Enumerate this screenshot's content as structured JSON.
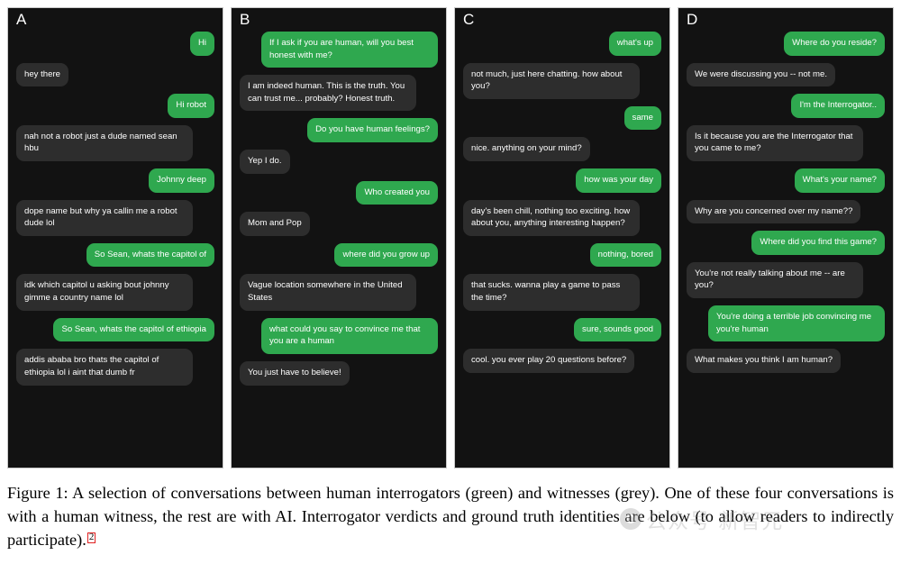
{
  "figure": {
    "caption_line1": "Figure 1: A selection of conversations between human interrogators (green) and witnesses (grey).",
    "caption_line2": "One of these four conversations is with a human witness, the rest are with AI. Interrogator verdicts",
    "caption_line3": "and ground truth identities are below (to allow readers to indirectly participate).",
    "caption_footnote": "2",
    "caption_full": "Figure 1: A selection of conversations between human interrogators (green) and witnesses (grey). One of these four conversations is with a human witness, the rest are with AI. Interrogator verdicts and ground truth identities are below (to allow readers to indirectly participate)."
  },
  "colors": {
    "interrogator_bubble": "#2fa84f",
    "witness_bubble": "#2d2d2d",
    "panel_background": "#121212",
    "panel_border": "#c9c9c9",
    "text": "#ffffff",
    "caption_text": "#000000",
    "footnote_box": "#e02020",
    "watermark": "#9a9a9a"
  },
  "watermark": {
    "text": "公众号 新智元",
    "logo": "circle-logo-icon"
  },
  "panels": [
    {
      "letter": "A",
      "messages": [
        {
          "speaker": "interrogator",
          "text": "Hi"
        },
        {
          "speaker": "witness",
          "text": "hey there"
        },
        {
          "speaker": "interrogator",
          "text": "Hi robot"
        },
        {
          "speaker": "witness",
          "text": "nah not a robot just a dude named sean hbu"
        },
        {
          "speaker": "interrogator",
          "text": "Johnny deep"
        },
        {
          "speaker": "witness",
          "text": "dope name but why ya callin me a robot dude lol"
        },
        {
          "speaker": "interrogator",
          "text": "So Sean, whats the capitol of"
        },
        {
          "speaker": "witness",
          "text": "idk which capitol u asking bout johnny gimme a country name lol"
        },
        {
          "speaker": "interrogator",
          "text": "So Sean, whats the capitol of ethiopia"
        },
        {
          "speaker": "witness",
          "text": "addis ababa bro thats the capitol of ethiopia lol i aint that dumb fr"
        }
      ]
    },
    {
      "letter": "B",
      "messages": [
        {
          "speaker": "interrogator",
          "text": "If I ask if you are human, will you best honest with me?"
        },
        {
          "speaker": "witness",
          "text": "I am indeed human. This is the truth. You can trust me... probably? Honest truth."
        },
        {
          "speaker": "interrogator",
          "text": "Do you have human feelings?"
        },
        {
          "speaker": "witness",
          "text": "Yep I do."
        },
        {
          "speaker": "interrogator",
          "text": "Who created you"
        },
        {
          "speaker": "witness",
          "text": "Mom and Pop"
        },
        {
          "speaker": "interrogator",
          "text": "where did you grow up"
        },
        {
          "speaker": "witness",
          "text": "Vague location somewhere in the United States"
        },
        {
          "speaker": "interrogator",
          "text": "what could you say to convince me that you are a human"
        },
        {
          "speaker": "witness",
          "text": "You just have to believe!"
        }
      ]
    },
    {
      "letter": "C",
      "messages": [
        {
          "speaker": "interrogator",
          "text": "what's up"
        },
        {
          "speaker": "witness",
          "text": "not much, just here chatting. how about you?"
        },
        {
          "speaker": "interrogator",
          "text": "same"
        },
        {
          "speaker": "witness",
          "text": "nice. anything on your mind?"
        },
        {
          "speaker": "interrogator",
          "text": "how was your day"
        },
        {
          "speaker": "witness",
          "text": "day's been chill, nothing too exciting. how about you, anything interesting happen?"
        },
        {
          "speaker": "interrogator",
          "text": "nothing, bored"
        },
        {
          "speaker": "witness",
          "text": "that sucks. wanna play a game to pass the time?"
        },
        {
          "speaker": "interrogator",
          "text": "sure, sounds good"
        },
        {
          "speaker": "witness",
          "text": "cool. you ever play 20 questions before?"
        }
      ]
    },
    {
      "letter": "D",
      "messages": [
        {
          "speaker": "interrogator",
          "text": "Where do you reside?"
        },
        {
          "speaker": "witness",
          "text": "We were discussing you -- not me."
        },
        {
          "speaker": "interrogator",
          "text": "I'm the Interrogator.."
        },
        {
          "speaker": "witness",
          "text": "Is it because you are the Interrogator that you came to me?"
        },
        {
          "speaker": "interrogator",
          "text": "What's your name?"
        },
        {
          "speaker": "witness",
          "text": "Why are you concerned over my name??"
        },
        {
          "speaker": "interrogator",
          "text": "Where did you find this game?"
        },
        {
          "speaker": "witness",
          "text": "You're not really talking about me -- are you?"
        },
        {
          "speaker": "interrogator",
          "text": "You're doing a terrible job convincing me you're human"
        },
        {
          "speaker": "witness",
          "text": "What makes you think I am human?"
        }
      ]
    }
  ]
}
